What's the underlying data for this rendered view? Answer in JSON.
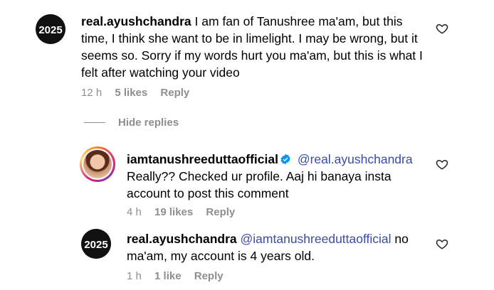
{
  "comments": [
    {
      "username": "real.ayushchandra",
      "avatar_text": "2025",
      "text": "I am fan of Tanushree ma'am, but this time, I think she want to be in limelight. I may be wrong, but it seems so. Sorry if my words hurt you ma'am, but this is what I felt after watching your video",
      "time": "12 h",
      "likes": "5 likes",
      "reply_label": "Reply"
    }
  ],
  "hide_replies_label": "Hide replies",
  "replies": [
    {
      "username": "iamtanushreeduttaofficial",
      "mention": "@real.ayushchandra",
      "text": "Really?? Checked ur profile. Aaj hi banaya insta account to post this comment",
      "time": "4 h",
      "likes": "19 likes",
      "reply_label": "Reply"
    },
    {
      "username": "real.ayushchandra",
      "avatar_text": "2025",
      "mention": "@iamtanushreeduttaofficial",
      "text": "no ma'am, my account is 4 years old.",
      "time": "1 h",
      "likes": "1 like",
      "reply_label": "Reply"
    }
  ],
  "icons": {
    "like": "heart-outline-icon",
    "verified": "verified-badge-icon"
  },
  "colors": {
    "mention": "#3b4ba6",
    "meta": "#8e8e8e",
    "verified": "#0095f6"
  }
}
